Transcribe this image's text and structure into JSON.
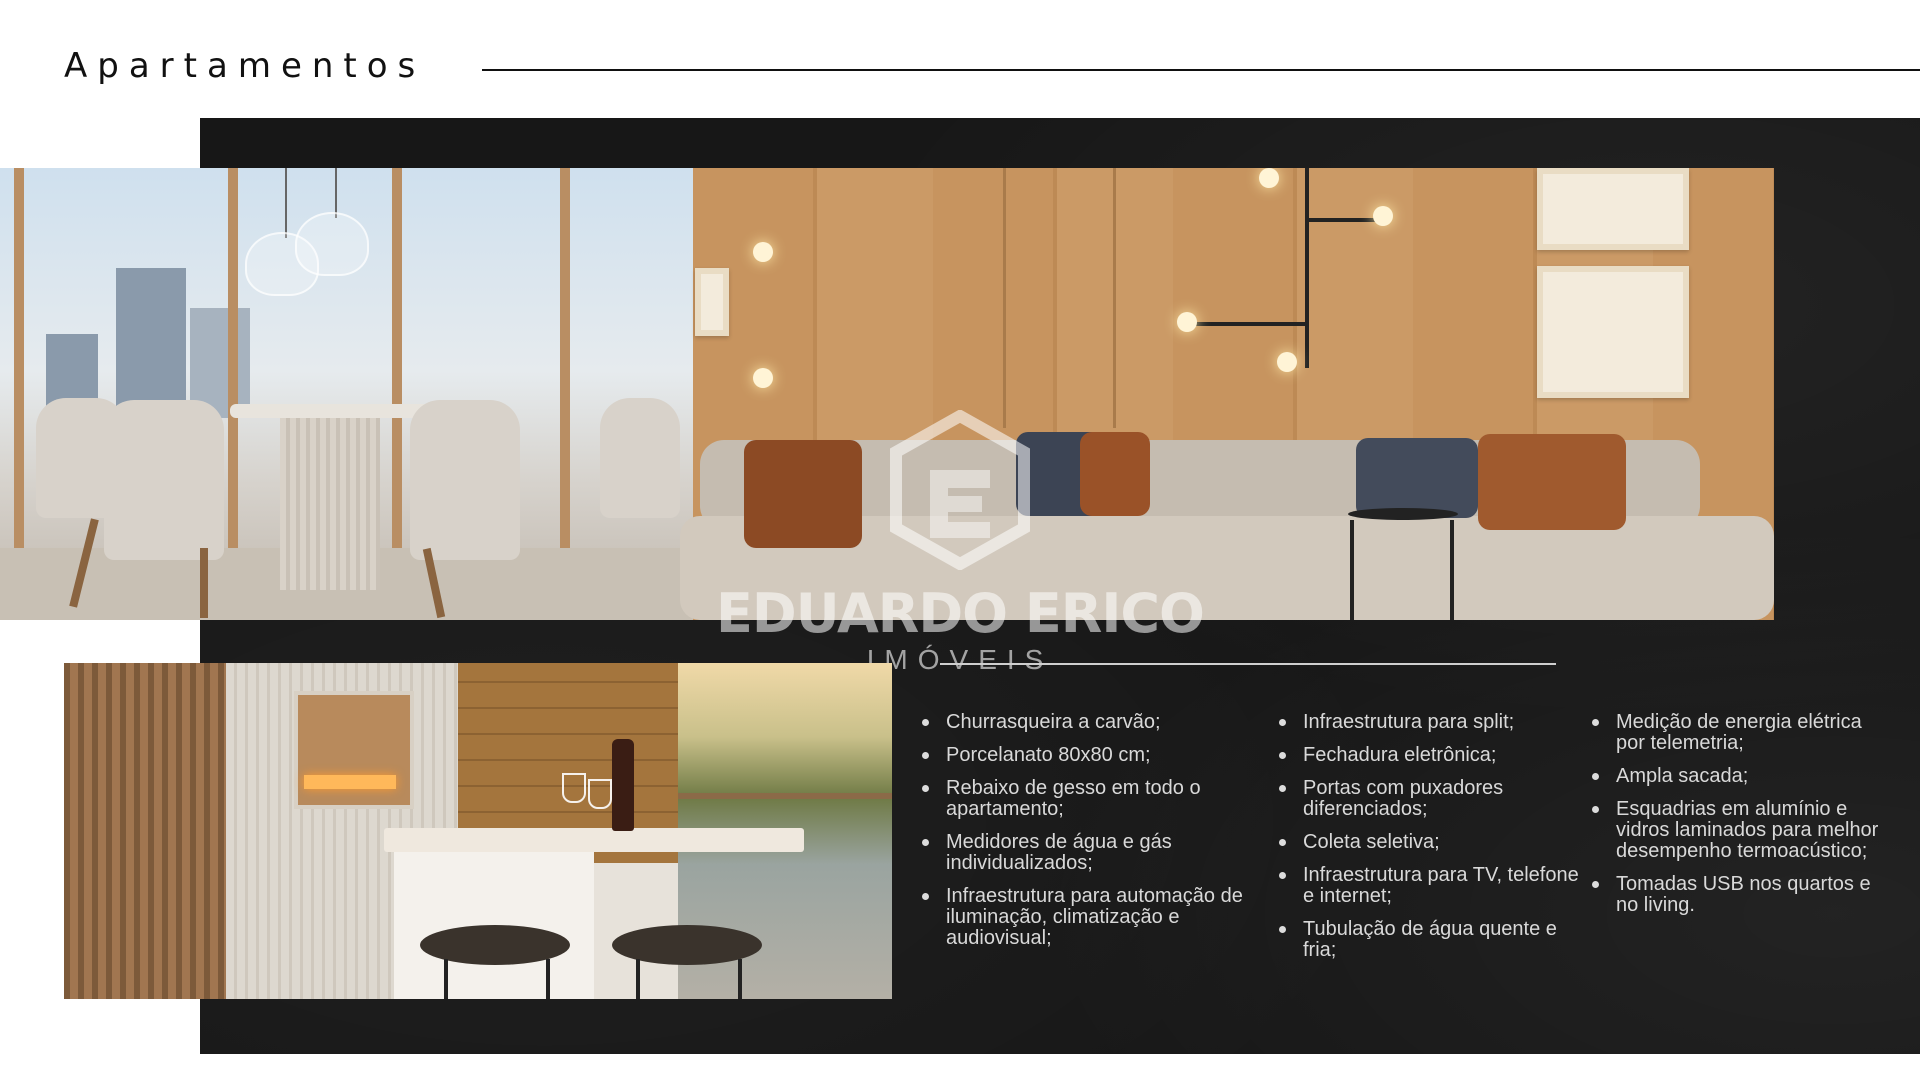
{
  "page": {
    "title": "Apartamentos"
  },
  "watermark": {
    "name": "EDUARDO ERICO",
    "subtitle": "IMÓVEIS"
  },
  "features": {
    "column1": [
      "Churrasqueira a carvão;",
      "Porcelanato 80x80 cm;",
      "Rebaixo de gesso em todo o apartamento;",
      "Medidores de água e gás individualizados;",
      "Infraestrutura para automação de iluminação, climatização e audiovisual;"
    ],
    "column2": [
      "Infraestrutura para split;",
      "Fechadura eletrônica;",
      "Portas com puxadores diferenciados;",
      "Coleta seletiva;",
      "Infraestrutura para TV, telefone e internet;",
      "Tubulação de água quente e fria;"
    ],
    "column3": [
      "Medição de energia elétrica por telemetria;",
      "Ampla sacada;",
      "Esquadrias em alumínio e vidros laminados para melhor desempenho termoacústico;",
      "Tomadas USB nos quartos e no living."
    ]
  },
  "colors": {
    "panel": "#171717",
    "text_light": "#d9d9d9",
    "title": "#111111"
  }
}
